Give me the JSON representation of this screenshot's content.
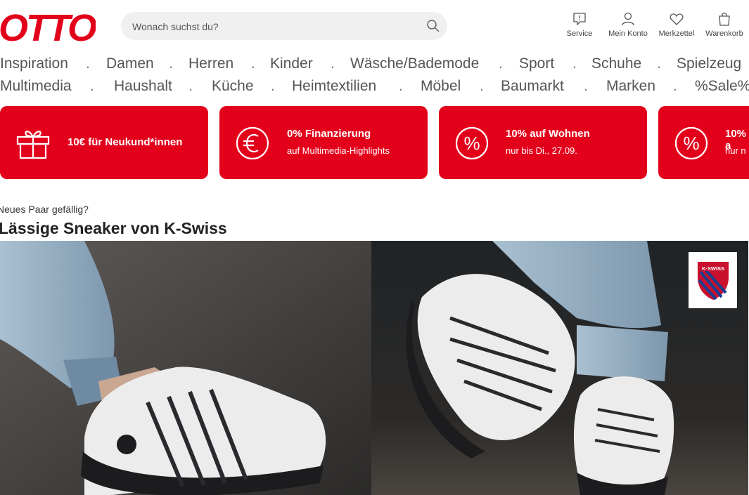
{
  "header": {
    "logo_text": "OTTO",
    "search_placeholder": "Wonach suchst du?",
    "actions": [
      {
        "label": "Service",
        "icon": "service-icon"
      },
      {
        "label": "Mein Konto",
        "icon": "account-icon"
      },
      {
        "label": "Merkzettel",
        "icon": "heart-icon"
      },
      {
        "label": "Warenkorb",
        "icon": "cart-icon"
      }
    ]
  },
  "nav": {
    "row1": [
      "Inspiration",
      "Damen",
      "Herren",
      "Kinder",
      "Wäsche/Bademode",
      "Sport",
      "Schuhe",
      "Spielzeug"
    ],
    "row2": [
      "Multimedia",
      "Haushalt",
      "Küche",
      "Heimtextilien",
      "Möbel",
      "Baumarkt",
      "Marken",
      "%Sale%"
    ],
    "separator": "."
  },
  "promos": [
    {
      "icon": "gift-icon",
      "title": "10€ für Neukund*innen",
      "sub": ""
    },
    {
      "icon": "euro-icon",
      "title": "0% Finanzierung",
      "sub": "auf Multimedia-Highlights"
    },
    {
      "icon": "percent-icon",
      "title": "10% auf Wohnen",
      "sub": "nur bis Di., 27.09."
    },
    {
      "icon": "percent-icon",
      "title": "10% a",
      "sub": "nur n"
    }
  ],
  "teaser": {
    "kicker": "Neues Paar gefällig?",
    "headline": "Lässige Sneaker von K-Swiss",
    "brand_badge": "K·SWISS"
  },
  "colors": {
    "brand_red": "#e3001b",
    "search_bg": "#f0f0f0"
  }
}
